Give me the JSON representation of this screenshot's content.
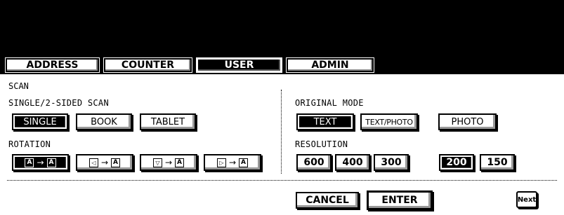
{
  "tabs": {
    "address": "ADDRESS",
    "counter": "COUNTER",
    "user": "USER",
    "admin": "ADMIN"
  },
  "scan": {
    "title": "SCAN",
    "sided_label": "SINGLE/2-SIDED SCAN",
    "sided_options": [
      "SINGLE",
      "BOOK",
      "TABLET"
    ],
    "sided_selected": "SINGLE",
    "rotation_label": "ROTATION",
    "rotation_selected_index": 0,
    "original_mode_label": "ORIGINAL MODE",
    "original_mode_options": [
      "TEXT",
      "TEXT/PHOTO",
      "PHOTO"
    ],
    "original_mode_selected": "TEXT",
    "resolution_label": "RESOLUTION",
    "resolution_options": [
      "600",
      "400",
      "300",
      "200",
      "150"
    ],
    "resolution_selected": "200"
  },
  "footer": {
    "cancel": "CANCEL",
    "enter": "ENTER",
    "next": "Next"
  },
  "glyphs": {
    "a_box": "A",
    "arrow": "→"
  }
}
